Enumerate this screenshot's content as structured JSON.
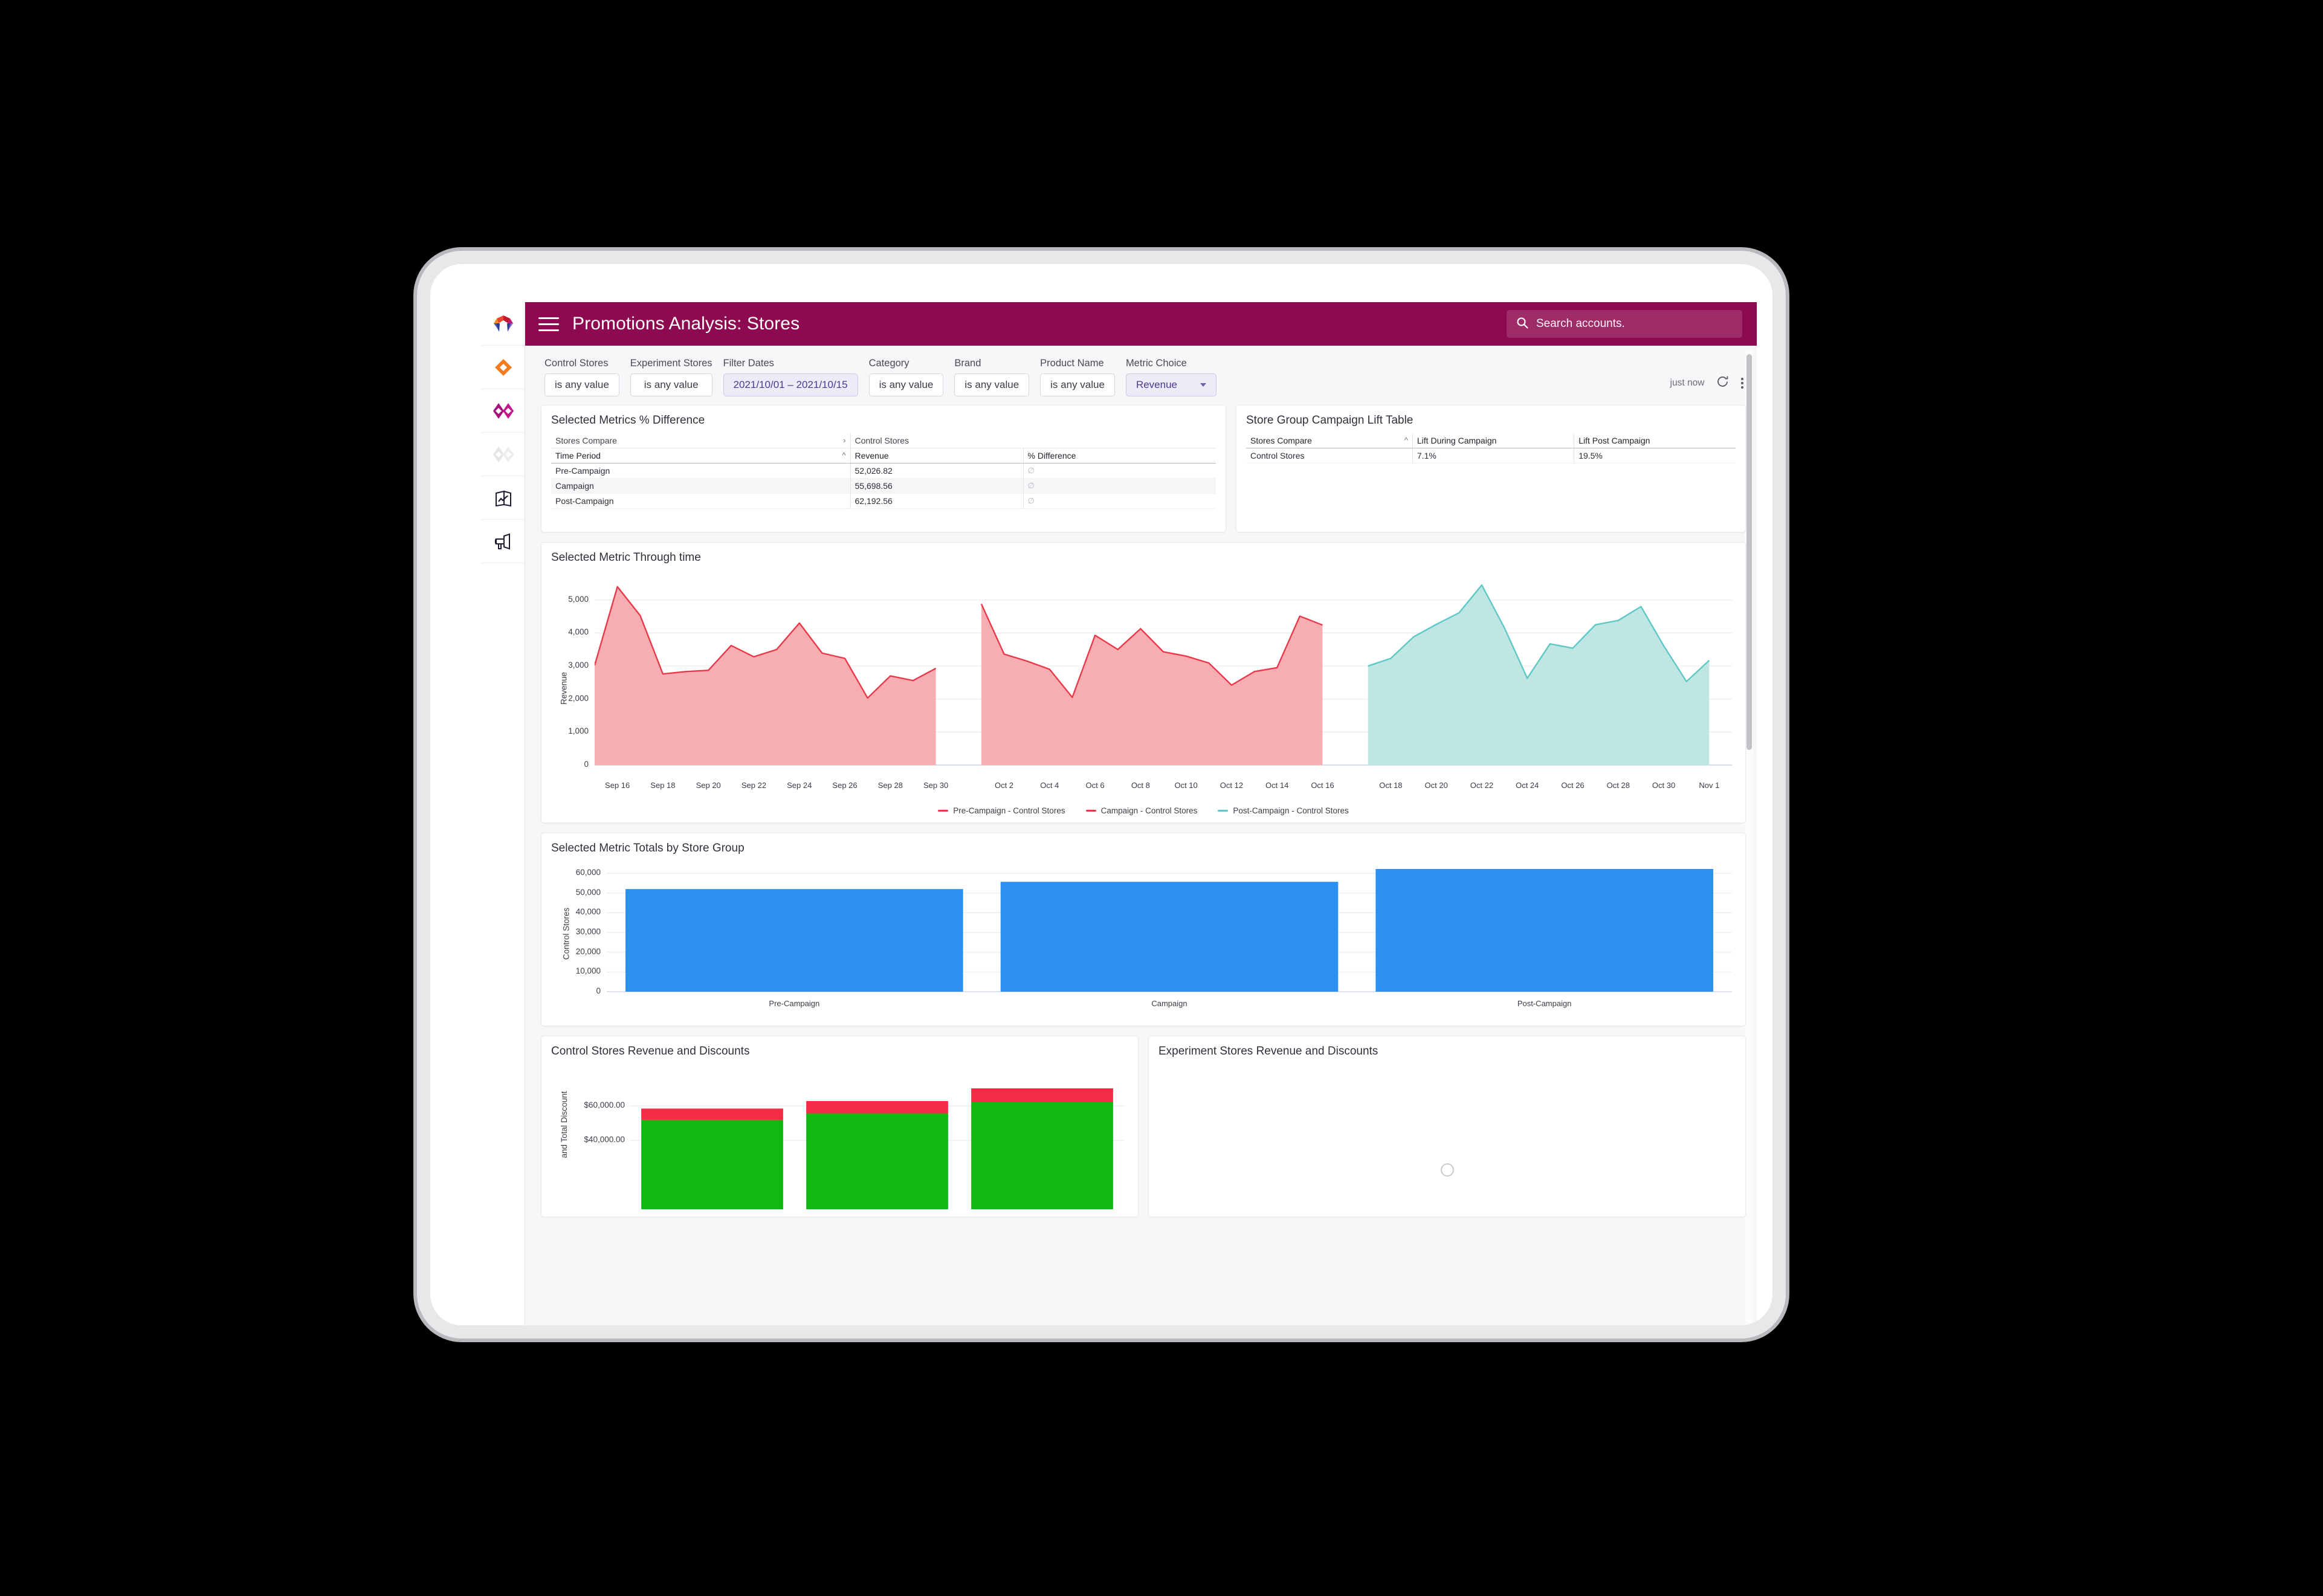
{
  "app": {
    "title": "Promotions Analysis: Stores",
    "search_placeholder": "Search accounts.",
    "brand_color": "#8d0a50"
  },
  "rail": {
    "items": [
      {
        "name": "looker-logo-icon",
        "label": "Looker"
      },
      {
        "name": "orange-diamond-icon",
        "label": "Explore"
      },
      {
        "name": "magenta-bowtie-icon",
        "label": "Develop"
      },
      {
        "name": "grey-bowtie-icon",
        "label": "Disabled"
      },
      {
        "name": "book-chart-icon",
        "label": "Reports"
      },
      {
        "name": "megaphone-icon",
        "label": "Campaigns"
      }
    ]
  },
  "filters": [
    {
      "label": "Control Stores",
      "value": "is any value",
      "style": "plain"
    },
    {
      "label": "Experiment Stores",
      "value": "is any value",
      "style": "plain"
    },
    {
      "label": "Filter Dates",
      "value": "2021/10/01 – 2021/10/15",
      "style": "highlight"
    },
    {
      "label": "Category",
      "value": "is any value",
      "style": "plain"
    },
    {
      "label": "Brand",
      "value": "is any value",
      "style": "plain"
    },
    {
      "label": "Product Name",
      "value": "is any value",
      "style": "plain"
    },
    {
      "label": "Metric Choice",
      "value": "Revenue",
      "style": "select"
    }
  ],
  "toolbar": {
    "timestamp": "just now",
    "refresh_icon": "refresh-icon",
    "menu_icon": "kebab-menu-icon",
    "bookmark_icon": "bookmark-check-icon"
  },
  "tiles": {
    "metrics_diff": {
      "title": "Selected Metrics % Difference",
      "group_header": {
        "left": "Stores Compare",
        "right": "Control Stores"
      },
      "columns": [
        "Time Period",
        "Revenue",
        "% Difference"
      ],
      "rows": [
        {
          "period": "Pre-Campaign",
          "revenue": "52,026.82",
          "diff": "∅"
        },
        {
          "period": "Campaign",
          "revenue": "55,698.56",
          "diff": "∅"
        },
        {
          "period": "Post-Campaign",
          "revenue": "62,192.56",
          "diff": "∅"
        }
      ]
    },
    "lift_table": {
      "title": "Store Group Campaign Lift Table",
      "columns": [
        "Stores Compare",
        "Lift During Campaign",
        "Lift Post Campaign"
      ],
      "rows": [
        {
          "group": "Control Stores",
          "during": "7.1%",
          "post": "19.5%"
        }
      ]
    },
    "timeseries": {
      "title": "Selected Metric Through time"
    },
    "totals": {
      "title": "Selected Metric Totals by Store Group"
    },
    "control_rev": {
      "title": "Control Stores Revenue and Discounts"
    },
    "experiment_rev": {
      "title": "Experiment Stores Revenue and Discounts"
    }
  },
  "chart_data": [
    {
      "id": "selected-metric-through-time",
      "type": "area",
      "title": "Selected Metric Through time",
      "ylabel": "Revenue",
      "xlabel": "",
      "ylim": [
        0,
        5600
      ],
      "yticks": [
        0,
        1000,
        2000,
        3000,
        4000,
        5000
      ],
      "ytick_labels": [
        "0",
        "1,000",
        "2,000",
        "3,000",
        "4,000",
        "5,000"
      ],
      "xticks": [
        "Sep 16",
        "Sep 18",
        "Sep 20",
        "Sep 22",
        "Sep 24",
        "Sep 26",
        "Sep 28",
        "Sep 30",
        "Oct 2",
        "Oct 4",
        "Oct 6",
        "Oct 8",
        "Oct 10",
        "Oct 12",
        "Oct 14",
        "Oct 16",
        "Oct 18",
        "Oct 20",
        "Oct 22",
        "Oct 24",
        "Oct 26",
        "Oct 28",
        "Oct 30",
        "Nov 1"
      ],
      "grid": true,
      "legend_position": "bottom",
      "series": [
        {
          "name": "Pre-Campaign - Control Stores",
          "color": "#e8394a",
          "fill": "#f7aeb2",
          "x": [
            "Sep 15",
            "Sep 16",
            "Sep 17",
            "Sep 18",
            "Sep 19",
            "Sep 20",
            "Sep 21",
            "Sep 22",
            "Sep 23",
            "Sep 24",
            "Sep 25",
            "Sep 26",
            "Sep 27",
            "Sep 28",
            "Sep 29",
            "Sep 30"
          ],
          "values": [
            3020,
            5400,
            4530,
            2760,
            2830,
            2870,
            3620,
            3280,
            3500,
            4300,
            3390,
            3230,
            2030,
            2700,
            2560,
            2930
          ]
        },
        {
          "name": "Campaign - Control Stores",
          "color": "#e8394a",
          "fill": "#f7aeb2",
          "x": [
            "Oct 1",
            "Oct 2",
            "Oct 3",
            "Oct 4",
            "Oct 5",
            "Oct 6",
            "Oct 7",
            "Oct 8",
            "Oct 9",
            "Oct 10",
            "Oct 11",
            "Oct 12",
            "Oct 13",
            "Oct 14",
            "Oct 15",
            "Oct 16"
          ],
          "values": [
            4880,
            3360,
            3150,
            2900,
            2050,
            3930,
            3500,
            4130,
            3430,
            3300,
            3090,
            2420,
            2830,
            2950,
            4510,
            4240
          ]
        },
        {
          "name": "Post-Campaign - Control Stores",
          "color": "#5ec8c6",
          "fill": "#bfe6e3",
          "x": [
            "Oct 17",
            "Oct 18",
            "Oct 19",
            "Oct 20",
            "Oct 21",
            "Oct 22",
            "Oct 23",
            "Oct 24",
            "Oct 25",
            "Oct 26",
            "Oct 27",
            "Oct 28",
            "Oct 29",
            "Oct 30",
            "Oct 31",
            "Nov 1"
          ],
          "values": [
            3000,
            3230,
            3880,
            4260,
            4610,
            5450,
            4150,
            2630,
            3670,
            3540,
            4250,
            4380,
            4800,
            3610,
            2530,
            3170
          ]
        }
      ]
    },
    {
      "id": "selected-metric-totals-by-store-group",
      "type": "bar",
      "title": "Selected Metric Totals by Store Group",
      "ylabel": "Control Stores",
      "xlabel": "",
      "categories": [
        "Pre-Campaign",
        "Campaign",
        "Post-Campaign"
      ],
      "values": [
        52026.82,
        55698.56,
        62192.56
      ],
      "ylim": [
        0,
        62500
      ],
      "yticks": [
        0,
        10000,
        20000,
        30000,
        40000,
        50000,
        60000
      ],
      "ytick_labels": [
        "0",
        "10,000",
        "20,000",
        "30,000",
        "40,000",
        "50,000",
        "60,000"
      ],
      "color": "#2b90f0",
      "grid": true
    },
    {
      "id": "control-stores-revenue-and-discounts",
      "type": "bar",
      "title": "Control Stores Revenue and Discounts",
      "ylabel": "and Total Discount",
      "categories": [
        "Pre-Campaign",
        "Campaign",
        "Post-Campaign"
      ],
      "yticks": [
        40000,
        60000
      ],
      "ytick_labels": [
        "$40,000.00",
        "$60,000.00"
      ],
      "series": [
        {
          "name": "Revenue",
          "color": "#11b811",
          "values": [
            52026.82,
            55698.56,
            62192.56
          ]
        },
        {
          "name": "Total Discount",
          "color": "#f42b45",
          "values": [
            6500,
            7200,
            8100
          ]
        }
      ],
      "grid": true
    },
    {
      "id": "experiment-stores-revenue-and-discounts",
      "type": "bar",
      "title": "Experiment Stores Revenue and Discounts",
      "categories": [],
      "series": [],
      "note": "loading"
    }
  ]
}
